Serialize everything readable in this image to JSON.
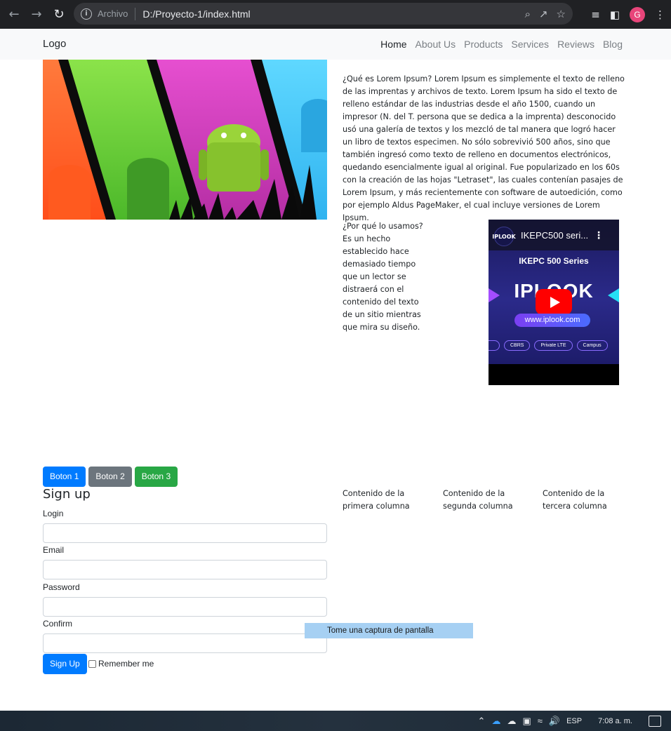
{
  "browser": {
    "site_label": "Archivo",
    "url": "D:/Proyecto-1/index.html",
    "profile_initial": "G"
  },
  "navbar": {
    "brand": "Logo",
    "links": [
      "Home",
      "About Us",
      "Products",
      "Services",
      "Reviews",
      "Blog"
    ]
  },
  "content": {
    "paragraph_1": "¿Qué es Lorem Ipsum? Lorem Ipsum es simplemente el texto de relleno de las imprentas y archivos de texto. Lorem Ipsum ha sido el texto de relleno estándar de las industrias desde el año 1500, cuando un impresor (N. del T. persona que se dedica a la imprenta) desconocido usó una galería de textos y los mezcló de tal manera que logró hacer un libro de textos especimen. No sólo sobrevivió 500 años, sino que también ingresó como texto de relleno en documentos electrónicos, quedando esencialmente igual al original. Fue popularizado en los 60s con la creación de las hojas \"Letraset\", las cuales contenían pasajes de Lorem Ipsum, y más recientemente con software de autoedición, como por ejemplo Aldus PageMaker, el cual incluye versiones de Lorem Ipsum.",
    "paragraph_2": "¿Por qué lo usamos? Es un hecho establecido hace demasiado tiempo que un lector se distraerá con el contenido del texto de un sitio mientras que mira su diseño."
  },
  "video": {
    "channel_logo": "IPLOOK",
    "title": "IKEPC500 seri...",
    "series": "IKEPC 500 Series",
    "brand": "IPLOOK",
    "url": "www.iplook.com",
    "tags": [
      "",
      "CBRS",
      "Private LTE",
      "Campus"
    ]
  },
  "buttons": [
    "Boton 1",
    "Boton 2",
    "Boton 3"
  ],
  "signup": {
    "title": "Sign up",
    "labels": {
      "login": "Login",
      "email": "Email",
      "password": "Password",
      "confirm": "Confirm"
    },
    "submit": "Sign Up",
    "remember": "Remember me"
  },
  "columns": [
    "Contenido de la primera columna",
    "Contenido de la segunda columna",
    "Contenido de la tercera columna"
  ],
  "overlay": {
    "capture_tooltip": "Tome una captura de pantalla"
  },
  "taskbar": {
    "language": "ESP",
    "time": "7:08 a. m."
  }
}
